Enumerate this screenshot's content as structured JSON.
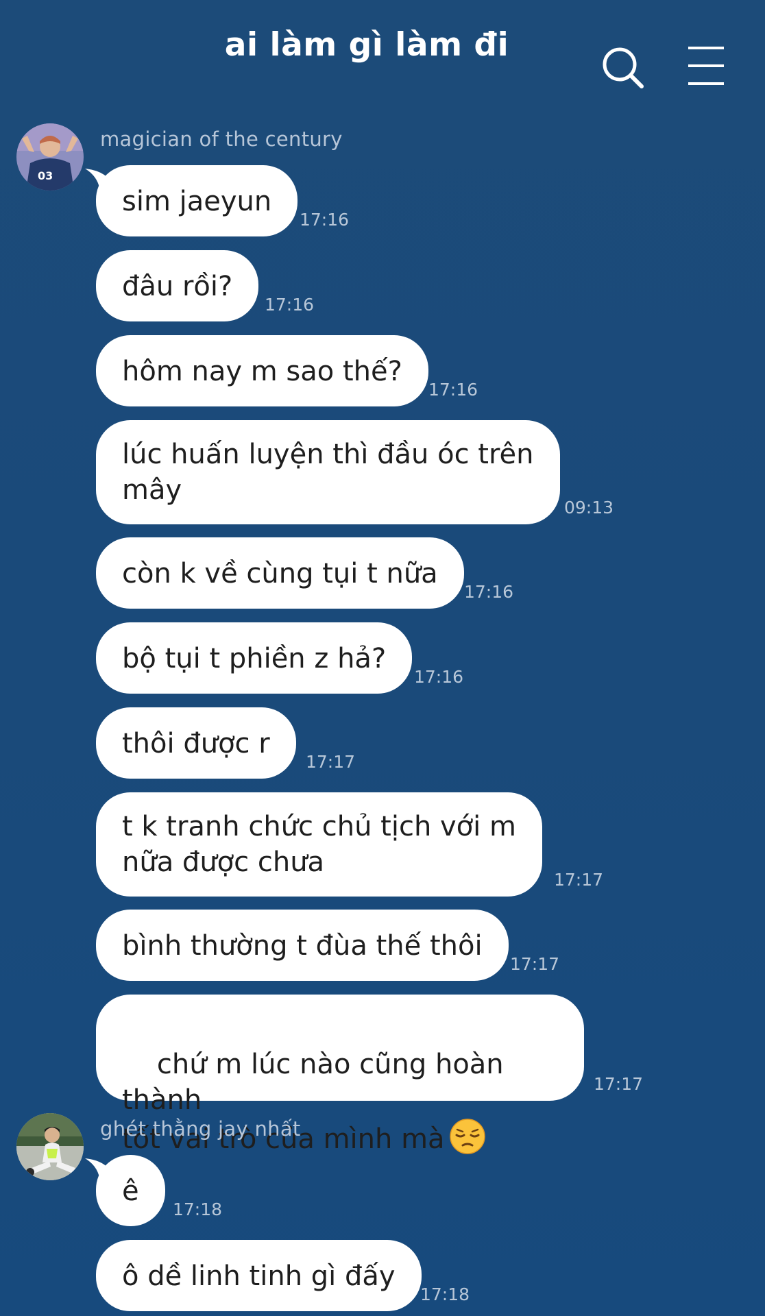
{
  "header": {
    "title": "ai làm gì làm đi",
    "search_icon": "search-icon",
    "menu_icon": "menu-icon"
  },
  "colors": {
    "background": "#1a4a7a",
    "bubble": "#ffffff",
    "text": "#1e1e1e",
    "meta": "#b8c7d8"
  },
  "groups": [
    {
      "sender": "magician of the century",
      "avatar": "avatar-photo",
      "messages": [
        {
          "text": "sim jaeyun",
          "time": "17:16"
        },
        {
          "text": "đâu rồi?",
          "time": "17:16"
        },
        {
          "text": "hôm nay m sao thế?",
          "time": "17:16"
        },
        {
          "text": "lúc huấn luyện thì đầu óc trên\nmây",
          "time": "09:13"
        },
        {
          "text": "còn k về cùng tụi t nữa",
          "time": "17:16"
        },
        {
          "text": "bộ tụi t phiền z hả?",
          "time": "17:16"
        },
        {
          "text": "thôi được r",
          "time": "17:17"
        },
        {
          "text": "t k tranh chức chủ tịch với m\nnữa được chưa",
          "time": "17:17"
        },
        {
          "text": "bình thường t đùa thế thôi",
          "time": "17:17"
        },
        {
          "text": "chứ m lúc nào cũng hoàn thành\ntốt vai trò của mình mà",
          "time": "17:17",
          "emoji": "pensive-face-emoji"
        }
      ]
    },
    {
      "sender": "ghét thằng jay nhất",
      "avatar": "avatar-photo",
      "messages": [
        {
          "text": "ê",
          "time": "17:18"
        },
        {
          "text": "ô dề linh tinh gì đấy",
          "time": "17:18"
        }
      ]
    }
  ]
}
